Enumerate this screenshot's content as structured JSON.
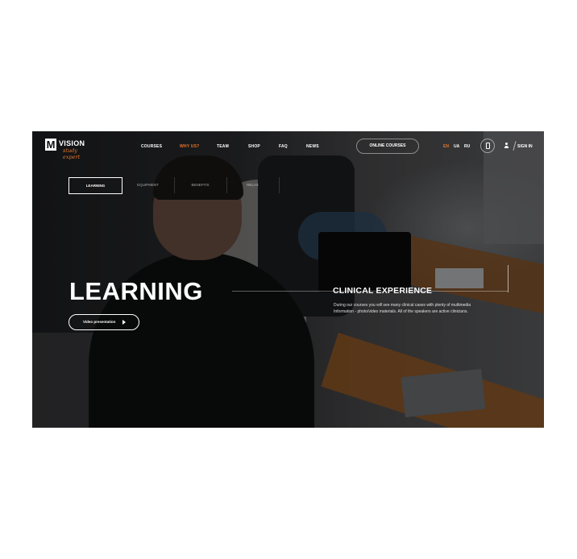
{
  "logo": {
    "mark": "M",
    "name": "VISION",
    "tagline": "study expert"
  },
  "nav": {
    "items": [
      {
        "label": "COURSES",
        "active": false
      },
      {
        "label": "WHY US?",
        "active": true
      },
      {
        "label": "TEAM",
        "active": false
      },
      {
        "label": "SHOP",
        "active": false
      },
      {
        "label": "FAQ",
        "active": false
      },
      {
        "label": "NEWS",
        "active": false
      }
    ],
    "online_courses": "ONLINE COURSES",
    "languages": [
      {
        "label": "EN",
        "active": true
      },
      {
        "label": "UA",
        "active": false
      },
      {
        "label": "RU",
        "active": false
      }
    ],
    "sign_in": "SIGN IN"
  },
  "tabs": [
    "LEARNING",
    "EQUIPMENT",
    "BENEFITS",
    "RELAX"
  ],
  "hero": {
    "title": "LEARNING",
    "video_button": "Video presentation",
    "section_title": "CLINICAL EXPERIENCE",
    "section_text": "During our courses you will see many clinical cases with plenty of multimedia Information - photo/video materials. All of the speakers are active clinicians."
  },
  "colors": {
    "accent": "#e8762c",
    "text": "#ffffff"
  },
  "icons": [
    "phone-icon",
    "user-icon",
    "play-icon"
  ]
}
